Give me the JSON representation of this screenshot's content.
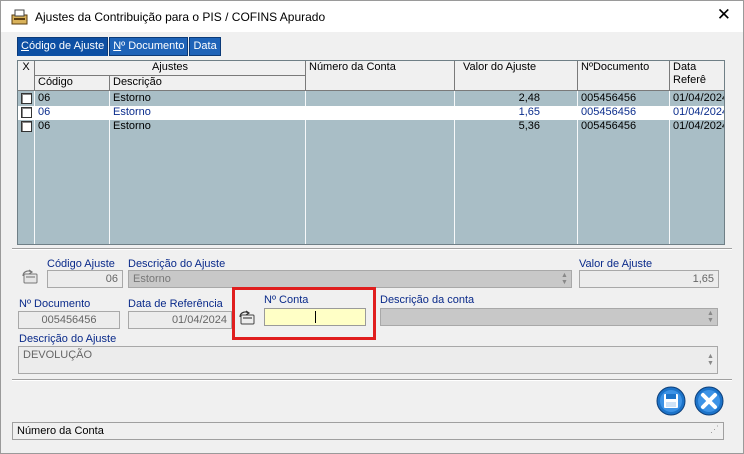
{
  "window": {
    "title": "Ajustes da Contribuição para o PIS / COFINS Apurado",
    "close_glyph": "✕"
  },
  "tabs": [
    {
      "label": "Código de Ajuste",
      "active": true
    },
    {
      "label": "Nº Documento",
      "active": false
    },
    {
      "label": "Data",
      "active": false
    }
  ],
  "grid": {
    "headers": {
      "x": "X",
      "ajustes": "Ajustes",
      "codigo": "Código",
      "descricao": "Descrição",
      "numero_conta": "Número da Conta",
      "valor_ajuste": "Valor do Ajuste",
      "n_documento": "NºDocumento",
      "data_ref": "Data Referê"
    },
    "rows": [
      {
        "codigo": "06",
        "descricao": "Estorno",
        "conta": "",
        "valor": "2,48",
        "documento": "005456456",
        "data": "01/04/2024",
        "selected": false
      },
      {
        "codigo": "06",
        "descricao": "Estorno",
        "conta": "",
        "valor": "1,65",
        "documento": "005456456",
        "data": "01/04/2024",
        "selected": true
      },
      {
        "codigo": "06",
        "descricao": "Estorno",
        "conta": "",
        "valor": "5,36",
        "documento": "005456456",
        "data": "01/04/2024",
        "selected": false
      }
    ]
  },
  "form": {
    "codigo_ajuste": {
      "label": "Código Ajuste",
      "value": "06"
    },
    "descricao_ajuste": {
      "label": "Descrição do Ajuste",
      "value": "Estorno"
    },
    "valor_ajuste": {
      "label": "Valor de Ajuste",
      "value": "1,65"
    },
    "n_documento": {
      "label": "Nº Documento",
      "value": "005456456"
    },
    "data_referencia": {
      "label": "Data de Referência",
      "value": "01/04/2024"
    },
    "n_conta": {
      "label": "Nº Conta",
      "value": ""
    },
    "descricao_conta": {
      "label": "Descrição da conta",
      "value": ""
    },
    "descricao_do_ajuste": {
      "label": "Descrição do Ajuste",
      "value": "DEVOLUÇÃO"
    }
  },
  "status_bar": {
    "text": "Número da Conta"
  },
  "colors": {
    "tab_blue": "#1e63b8",
    "grid_bg": "#a9bec6",
    "label_blue": "#0a2a8a",
    "highlight_red": "#e01e1e",
    "field_yellow": "#ffffc6"
  },
  "icons": {
    "app": "app-window-icon",
    "save": "save-disk-icon",
    "exit": "close-x-icon",
    "search_left": "lookup-icon",
    "search_conta": "lookup-icon"
  }
}
